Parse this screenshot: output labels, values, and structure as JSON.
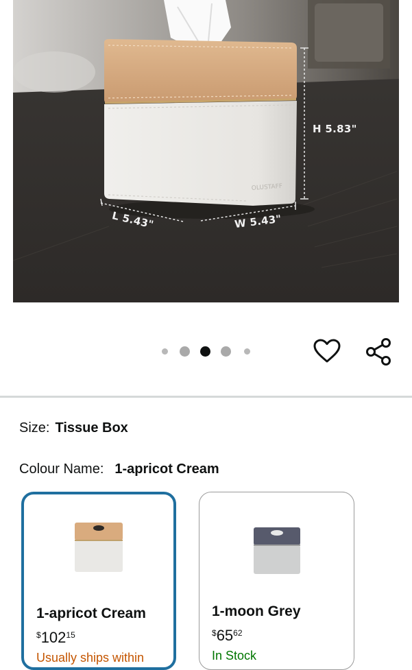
{
  "product_image": {
    "dimensions": {
      "height": "H 5.83\"",
      "length": "L 5.43\"",
      "width": "W 5.43\""
    },
    "logo_text": "OLUSTAFF"
  },
  "carousel": {
    "total": 5,
    "active_index": 2
  },
  "actions": {
    "wishlist_icon": "heart-outline-icon",
    "share_icon": "share-icon"
  },
  "size": {
    "label": "Size:",
    "value": "Tissue Box"
  },
  "colour": {
    "label": "Colour Name:",
    "value": "1-apricot Cream"
  },
  "options": [
    {
      "name": "1-apricot Cream",
      "price_currency": "$",
      "price_whole": "102",
      "price_fraction": "15",
      "availability": "Usually ships within",
      "availability_color": "#c45500",
      "selected": true
    },
    {
      "name": "1-moon Grey",
      "price_currency": "$",
      "price_whole": "65",
      "price_fraction": "62",
      "availability": "In Stock",
      "availability_color": "#007600",
      "selected": false
    }
  ],
  "colors": {
    "selected_border": "#1f6f9f",
    "divider": "#d5d9d9"
  }
}
